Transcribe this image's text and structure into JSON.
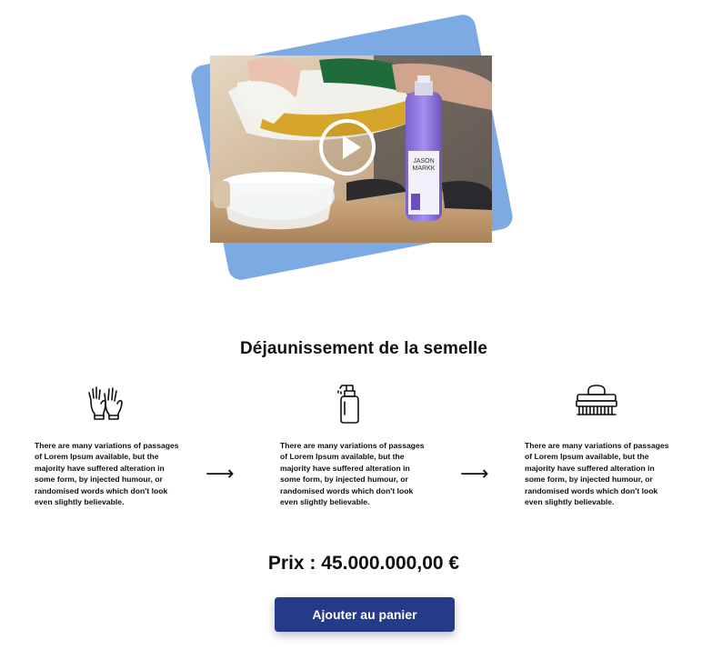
{
  "colors": {
    "accent_card": "#7eaae4",
    "button_bg": "#253a89",
    "button_text": "#ffffff",
    "text": "#111111"
  },
  "media": {
    "play_icon": "play-icon",
    "bottle_label_line1": "JASON",
    "bottle_label_line2": "MARKK"
  },
  "service": {
    "title": "Déjaunissement de la semelle"
  },
  "steps": [
    {
      "icon": "gloves-icon",
      "text": "There are many variations of passages of Lorem Ipsum available, but the majority have suffered alteration in some form, by injected humour, or randomised words which don't look even slightly believable."
    },
    {
      "icon": "spray-bottle-icon",
      "text": "There are many variations of passages of Lorem Ipsum available, but the majority have suffered alteration in some form, by injected humour, or randomised words which don't look even slightly believable."
    },
    {
      "icon": "brush-icon",
      "text": "There are many variations of passages of Lorem Ipsum available, but the majority have suffered alteration in some form, by injected humour, or randomised words which don't look even slightly believable."
    }
  ],
  "arrows": [
    "⟶",
    "⟶"
  ],
  "pricing": {
    "price_text": "Prix : 45.000.000,00 €"
  },
  "cart": {
    "button_label": "Ajouter au panier"
  }
}
